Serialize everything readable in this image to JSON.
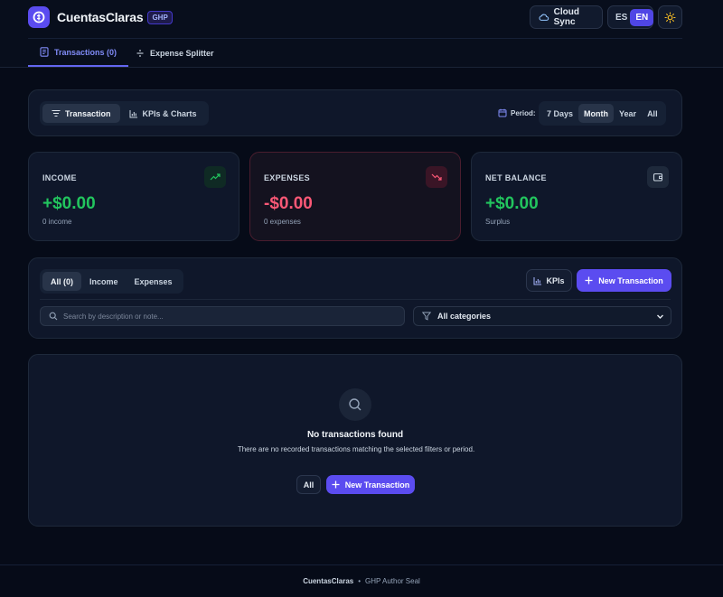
{
  "app": {
    "name": "CuentasClaras",
    "badge": "GHP"
  },
  "header": {
    "cloud_sync": "Cloud Sync",
    "lang_es": "ES",
    "lang_en": "EN",
    "tabs": [
      {
        "label": "Transactions (0)",
        "icon": "receipt-icon"
      },
      {
        "label": "Expense Splitter",
        "icon": "divide-icon"
      }
    ]
  },
  "toolbar": {
    "views": [
      {
        "label": "Transaction",
        "icon": "filter-lines-icon"
      },
      {
        "label": "KPIs & Charts",
        "icon": "bar-chart-icon"
      }
    ],
    "period_label": "Period:",
    "periods": [
      "7 Days",
      "Month",
      "Year",
      "All"
    ],
    "selected_period": "Month"
  },
  "kpis": {
    "income": {
      "title": "INCOME",
      "value": "+$0.00",
      "sub": "0 income"
    },
    "expenses": {
      "title": "EXPENSES",
      "value": "-$0.00",
      "sub": "0 expenses"
    },
    "balance": {
      "title": "NET BALANCE",
      "value": "+$0.00",
      "sub": "Surplus"
    }
  },
  "filters": {
    "types": [
      "All (0)",
      "Income",
      "Expenses"
    ],
    "kpis_button": "KPIs",
    "new_button": "New Transaction",
    "search_placeholder": "Search by description or note...",
    "category": "All categories"
  },
  "empty": {
    "title": "No transactions found",
    "description": "There are no recorded transactions matching the selected filters or period.",
    "all_button": "All",
    "new_button": "New Transaction"
  },
  "footer": {
    "brand": "CuentasClaras",
    "separator": "•",
    "text": "GHP Author Seal"
  },
  "colors": {
    "accent": "#5b4cf0",
    "income": "#22c55e",
    "expense": "#fb5876"
  }
}
